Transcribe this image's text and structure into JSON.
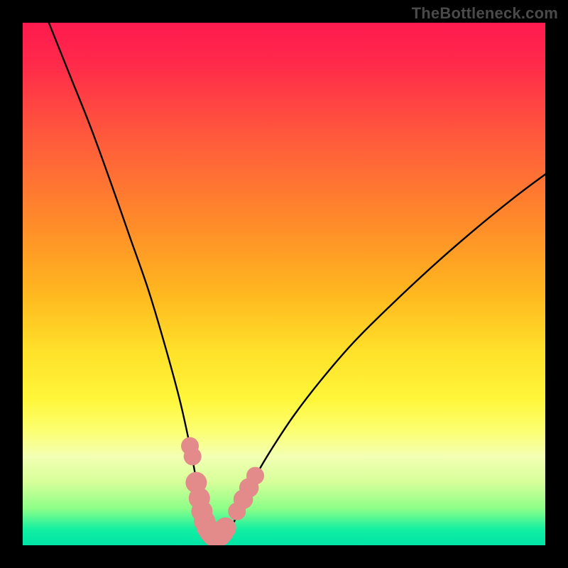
{
  "watermark": {
    "text": "TheBottleneck.com"
  },
  "colors": {
    "curve": "#000000",
    "marker_fill": "#e38a8a",
    "marker_stroke": "#c76262",
    "frame": "#000000"
  },
  "chart_data": {
    "type": "line",
    "title": "",
    "xlabel": "",
    "ylabel": "",
    "x_range": [
      0,
      100
    ],
    "y_range": [
      0,
      100
    ],
    "notch_x": 37,
    "series": [
      {
        "name": "bottleneck-curve",
        "points": [
          {
            "x": 5.0,
            "y": 100.0
          },
          {
            "x": 9.0,
            "y": 90.0
          },
          {
            "x": 13.0,
            "y": 80.0
          },
          {
            "x": 17.0,
            "y": 69.0
          },
          {
            "x": 20.5,
            "y": 59.0
          },
          {
            "x": 24.0,
            "y": 49.0
          },
          {
            "x": 27.0,
            "y": 39.0
          },
          {
            "x": 30.0,
            "y": 28.0
          },
          {
            "x": 32.0,
            "y": 19.0
          },
          {
            "x": 33.5,
            "y": 11.0
          },
          {
            "x": 34.8,
            "y": 5.5
          },
          {
            "x": 36.0,
            "y": 2.2
          },
          {
            "x": 37.0,
            "y": 1.0
          },
          {
            "x": 38.2,
            "y": 1.3
          },
          {
            "x": 39.6,
            "y": 3.0
          },
          {
            "x": 41.2,
            "y": 6.0
          },
          {
            "x": 42.8,
            "y": 9.5
          },
          {
            "x": 45.0,
            "y": 14.0
          },
          {
            "x": 48.0,
            "y": 19.0
          },
          {
            "x": 52.0,
            "y": 25.0
          },
          {
            "x": 57.0,
            "y": 31.5
          },
          {
            "x": 63.0,
            "y": 38.5
          },
          {
            "x": 70.0,
            "y": 45.5
          },
          {
            "x": 78.0,
            "y": 53.0
          },
          {
            "x": 86.0,
            "y": 60.0
          },
          {
            "x": 94.0,
            "y": 66.5
          },
          {
            "x": 100.0,
            "y": 71.0
          }
        ]
      }
    ],
    "markers": [
      {
        "x": 32.0,
        "y": 19.0,
        "r": 1.2
      },
      {
        "x": 32.5,
        "y": 17.0,
        "r": 1.2
      },
      {
        "x": 33.2,
        "y": 12.0,
        "r": 1.6
      },
      {
        "x": 33.8,
        "y": 9.0,
        "r": 1.6
      },
      {
        "x": 34.3,
        "y": 6.5,
        "r": 1.6
      },
      {
        "x": 34.8,
        "y": 4.6,
        "r": 1.6
      },
      {
        "x": 35.3,
        "y": 3.4,
        "r": 1.6
      },
      {
        "x": 35.8,
        "y": 2.6,
        "r": 1.6
      },
      {
        "x": 36.3,
        "y": 2.0,
        "r": 1.6
      },
      {
        "x": 36.8,
        "y": 1.6,
        "r": 1.6
      },
      {
        "x": 37.3,
        "y": 1.6,
        "r": 1.6
      },
      {
        "x": 37.8,
        "y": 1.9,
        "r": 1.6
      },
      {
        "x": 38.3,
        "y": 2.5,
        "r": 1.6
      },
      {
        "x": 38.8,
        "y": 3.3,
        "r": 1.6
      },
      {
        "x": 41.0,
        "y": 6.5,
        "r": 1.2
      },
      {
        "x": 42.2,
        "y": 8.8,
        "r": 1.4
      },
      {
        "x": 43.3,
        "y": 11.0,
        "r": 1.4
      },
      {
        "x": 44.5,
        "y": 13.3,
        "r": 1.2
      }
    ]
  }
}
